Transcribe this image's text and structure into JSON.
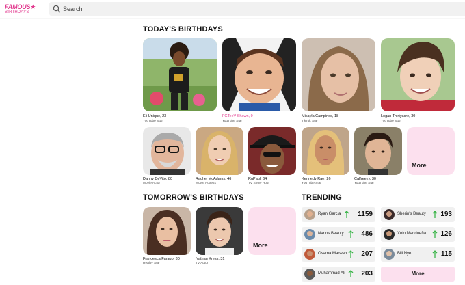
{
  "header": {
    "logo_top": "FAMOUS★",
    "logo_bottom": "BIRTHDAYS",
    "search_placeholder": "Search"
  },
  "today": {
    "title": "TODAY'S BIRTHDAYS",
    "row1": [
      {
        "name": "Eli Unique, 23",
        "role": "YouTube Star",
        "highlight": false
      },
      {
        "name": "FGTeeV Shawn, 9",
        "role": "YouTube Star",
        "highlight": true
      },
      {
        "name": "Mikayla Campinos, 18",
        "role": "TikTok Star",
        "highlight": false
      },
      {
        "name": "Logan Thirtyacre, 30",
        "role": "YouTube Star",
        "highlight": false
      }
    ],
    "row2": [
      {
        "name": "Danny DeVito, 80",
        "role": "Movie Actor"
      },
      {
        "name": "Rachel McAdams, 46",
        "role": "Movie Actress"
      },
      {
        "name": "RuPaul, 64",
        "role": "TV Show Host"
      },
      {
        "name": "Kennedy Rae, 26",
        "role": "YouTube Star"
      },
      {
        "name": "Calfreezy, 30",
        "role": "YouTube Star"
      }
    ],
    "more_label": "More"
  },
  "tomorrow": {
    "title": "TOMORROW'S BIRTHDAYS",
    "people": [
      {
        "name": "Francesca Farago, 30",
        "role": "Reality Star"
      },
      {
        "name": "Nathan Kress, 31",
        "role": "TV Actor"
      }
    ],
    "more_label": "More"
  },
  "trending": {
    "title": "TRENDING",
    "items": [
      {
        "name": "Ryan Garcia",
        "count": "1159"
      },
      {
        "name": "Sherin's Beauty",
        "count": "193"
      },
      {
        "name": "Narins Beauty",
        "count": "486"
      },
      {
        "name": "Xolo Maridueña",
        "count": "126"
      },
      {
        "name": "Osama Marwah",
        "count": "207"
      },
      {
        "name": "Bill Nye",
        "count": "115"
      },
      {
        "name": "Muhammad Ali",
        "count": "203"
      }
    ],
    "more_label": "More"
  },
  "colors": {
    "accent": "#e23b8f",
    "more_tile": "#fce0ee",
    "trend_arrow": "#3bb54a"
  }
}
